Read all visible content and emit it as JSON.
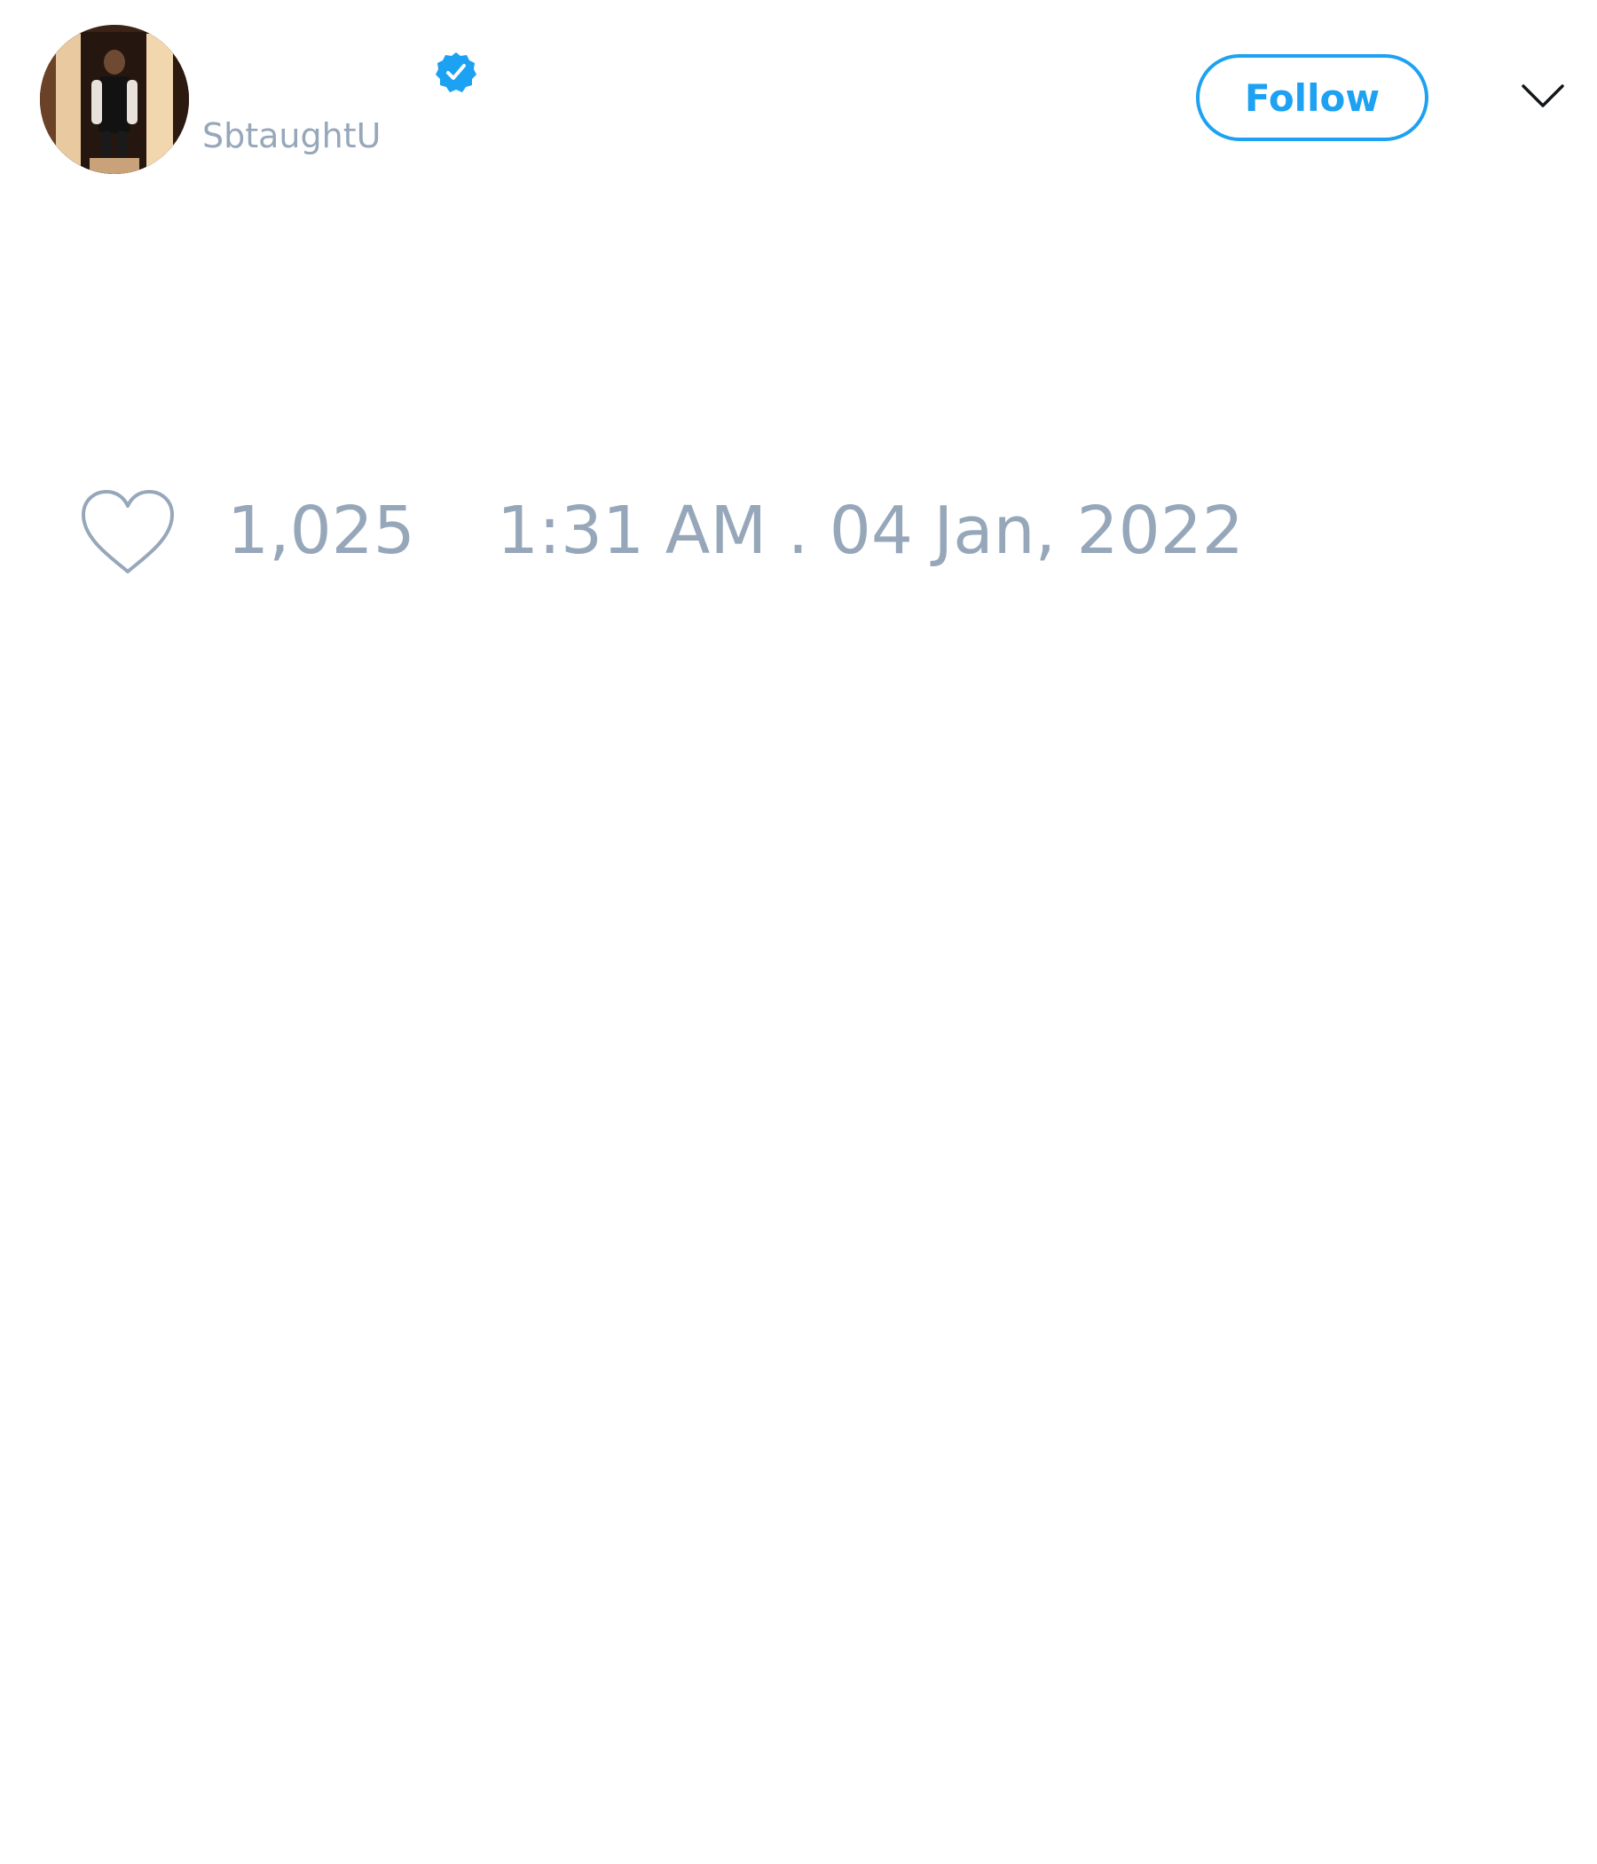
{
  "author": {
    "display_name": "",
    "handle": "SbtaughtU",
    "verified": true,
    "avatar_icon": "profile-photo"
  },
  "header": {
    "follow_label": "Follow",
    "menu_icon": "chevron-down-icon"
  },
  "tweet": {
    "like_icon": "heart-icon",
    "like_count": "1,025",
    "timestamp": "1:31 AM . 04 Jan, 2022"
  },
  "colors": {
    "accent": "#1da1f2",
    "muted_text": "#97a7ba",
    "background": "#ffffff"
  }
}
